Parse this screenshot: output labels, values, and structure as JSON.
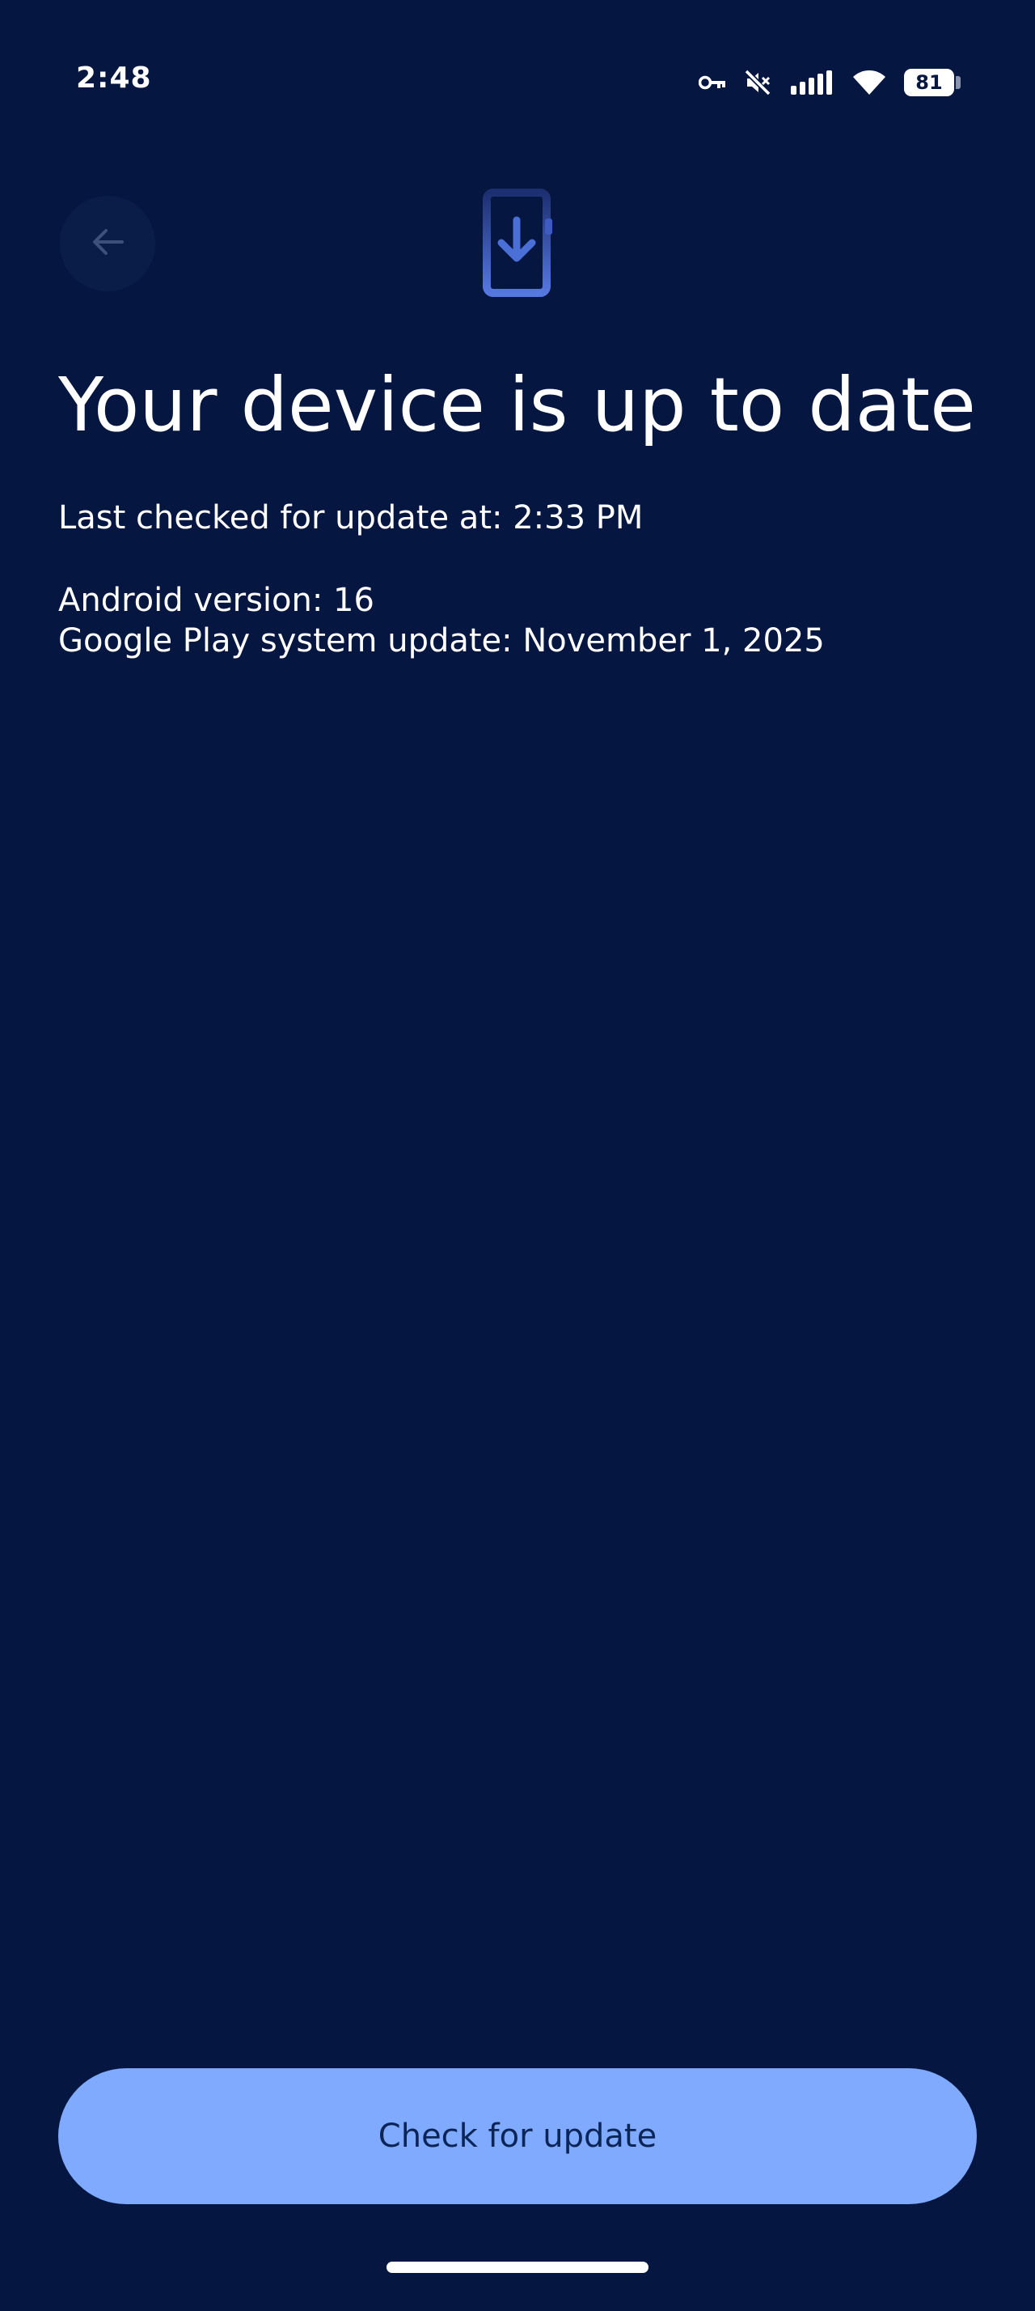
{
  "status_bar": {
    "time": "2:48",
    "battery_level": "81",
    "icons": [
      "vpn-key-icon",
      "mute-icon",
      "signal-icon",
      "wifi-icon",
      "battery-icon"
    ]
  },
  "header": {
    "back_icon": "arrow-back-icon",
    "illustration_icon": "system-update-phone-icon"
  },
  "main": {
    "title": "Your device is up to date",
    "last_checked": "Last checked for update at: 2:33 PM",
    "android_version": "Android version: 16",
    "play_system_update": "Google Play system update: November 1, 2025"
  },
  "footer": {
    "check_button_label": "Check for update"
  },
  "colors": {
    "background": "#051641",
    "button": "#7faafd",
    "button_text": "#0c2559",
    "icon_accent": "#4a6fd6"
  }
}
